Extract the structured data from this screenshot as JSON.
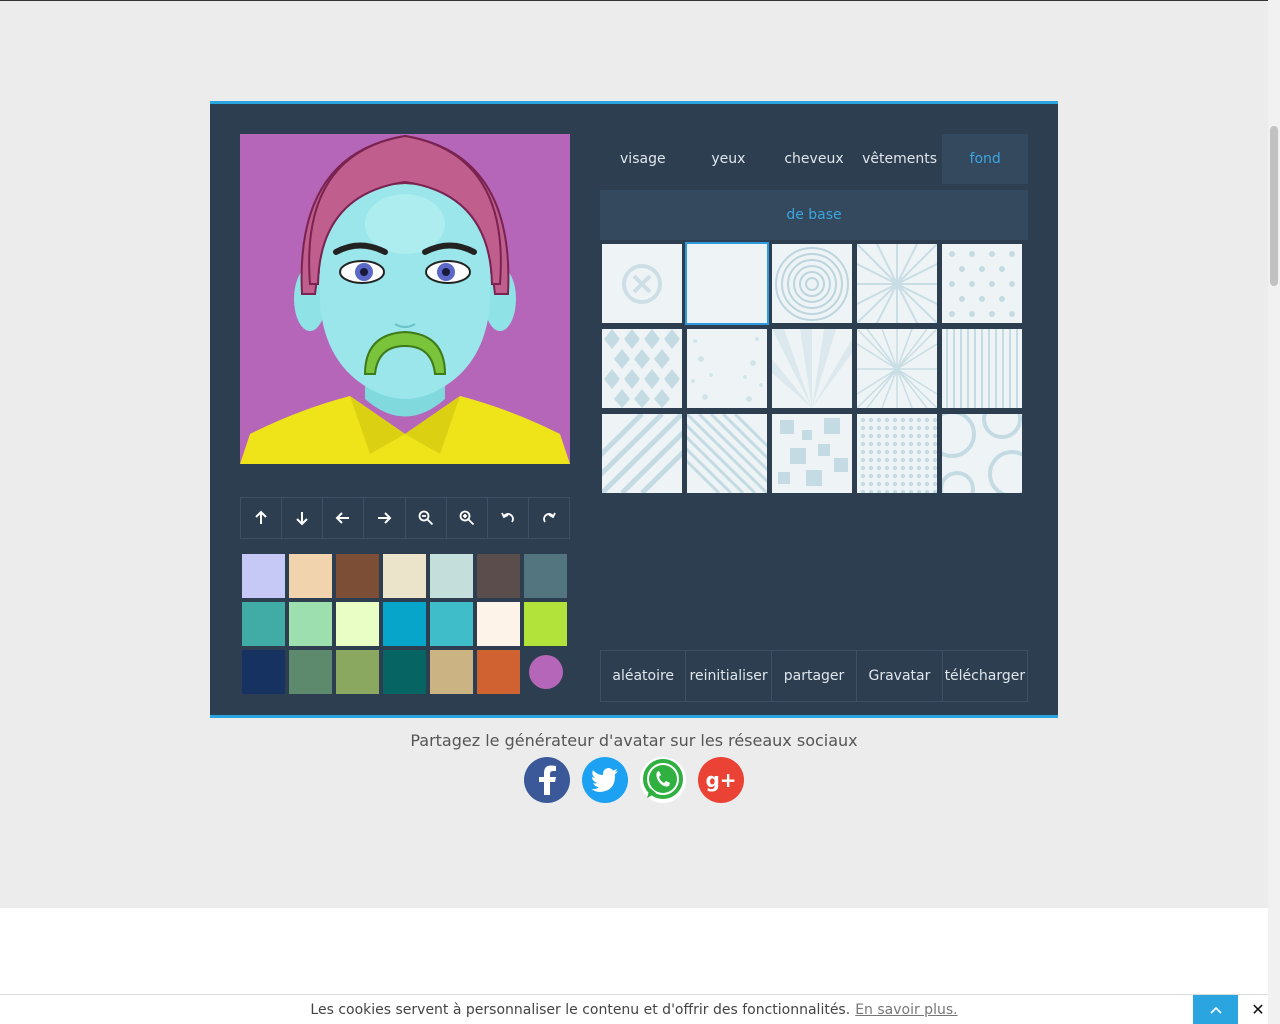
{
  "tabs": {
    "visage": "visage",
    "yeux": "yeux",
    "cheveux": "cheveux",
    "vetements": "vêtements",
    "fond": "fond"
  },
  "subtab": "de base",
  "actions": {
    "aleatoire": "aléatoire",
    "reinitialiser": "reinitialiser",
    "partager": "partager",
    "gravatar": "Gravatar",
    "telecharger": "télécharger"
  },
  "toolbar_icons": [
    "arrow-up-icon",
    "arrow-down-icon",
    "arrow-left-icon",
    "arrow-right-icon",
    "zoom-out-icon",
    "zoom-in-icon",
    "rotate-left-icon",
    "rotate-right-icon"
  ],
  "colors": {
    "accent": "#2aa5df",
    "panel": "#2d3e50",
    "selected_background": "#b566b8",
    "swatches": [
      "#c6c8f5",
      "#f1d3ae",
      "#7b4e35",
      "#ece3cb",
      "#c4dedc",
      "#5a4d4b",
      "#527580",
      "#41aba6",
      "#9edfb0",
      "#e8fec5",
      "#06a5c9",
      "#3fbec9",
      "#fdf3e8",
      "#b2e33a",
      "#163261",
      "#5d8a6c",
      "#8ba860",
      "#066463",
      "#cbb384",
      "#cf6230",
      "#b566b8"
    ]
  },
  "share": {
    "title": "Partagez le générateur d'avatar sur les réseaux sociaux",
    "networks": [
      "facebook",
      "twitter",
      "whatsapp",
      "google-plus"
    ],
    "google_plus_label": "g+"
  },
  "cookie": {
    "text": "Les cookies servent à personnaliser le contenu et d'offrir des fonctionnalités.",
    "link": "En savoir plus.",
    "close": "✕"
  }
}
